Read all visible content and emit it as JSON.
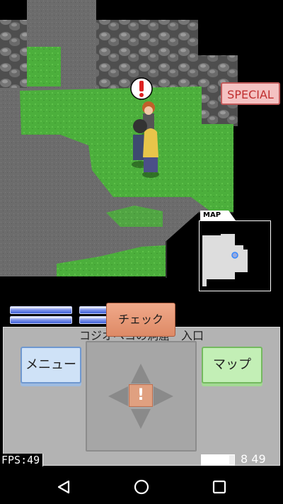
{
  "hud": {
    "special_label": "SPECIAL",
    "map_label": "MAP"
  },
  "panel": {
    "check_label": "チェック",
    "location": "コジオベコの洞窟　入口",
    "menu_label": "メニュー",
    "map_label": "マップ",
    "dpad_action_symbol": "!"
  },
  "status": {
    "fps": "FPS:49",
    "battery_level": 0.85,
    "time": "8 49"
  },
  "icons": {
    "nav_back": "back-triangle-icon",
    "nav_home": "home-circle-icon",
    "nav_recent": "recent-square-icon"
  },
  "colors": {
    "grass": "#4caf3c",
    "rock": "#5f5f5f",
    "floor": "#707070",
    "special_border": "#c05a5a",
    "check_fill": "#e4957a",
    "menu_fill": "#cfe2f7",
    "map_fill": "#c3efb6"
  }
}
